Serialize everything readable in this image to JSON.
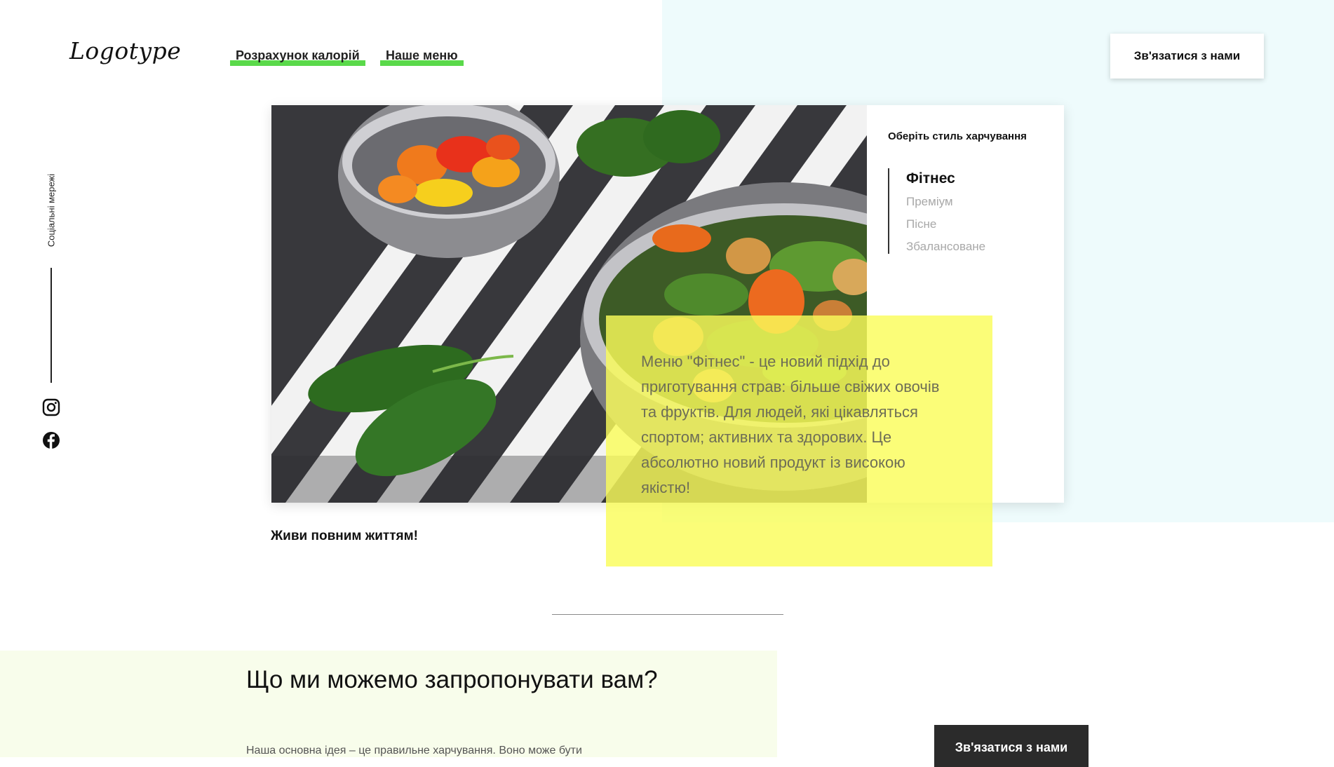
{
  "header": {
    "logo": "Logotype",
    "nav": [
      {
        "label": "Розрахунок калорій"
      },
      {
        "label": "Наше меню"
      }
    ],
    "contact_button": "Зв'язатися з нами"
  },
  "social": {
    "label": "Соціальні мережі",
    "icons": [
      "instagram-icon",
      "facebook-icon"
    ]
  },
  "card": {
    "panel_title": "Оберіть стиль харчування",
    "styles": [
      {
        "label": "Фітнес",
        "active": true
      },
      {
        "label": "Преміум",
        "active": false
      },
      {
        "label": "Пісне",
        "active": false
      },
      {
        "label": "Збалансоване",
        "active": false
      }
    ],
    "description": "Меню \"Фітнес\" - це новий підхід до приготування страв: більше свіжих овочів та фруктів. Для людей, які цікавляться спортом; активних та здорових. Це абсолютно новий продукт із високою якістю!"
  },
  "tagline": "Живи повним життям!",
  "offer": {
    "heading": "Що ми можемо запропонувати вам?",
    "text": "Наша основна ідея – це правильне харчування. Воно може бути"
  },
  "bottom_button": "Зв'язатися з нами",
  "colors": {
    "accent_green": "#5ad94a",
    "highlight_yellow": "#fafd5a",
    "bg_cyan": "#eefbfc",
    "bg_lime": "#f8fdeb",
    "dark_button": "#2b2b2b"
  }
}
